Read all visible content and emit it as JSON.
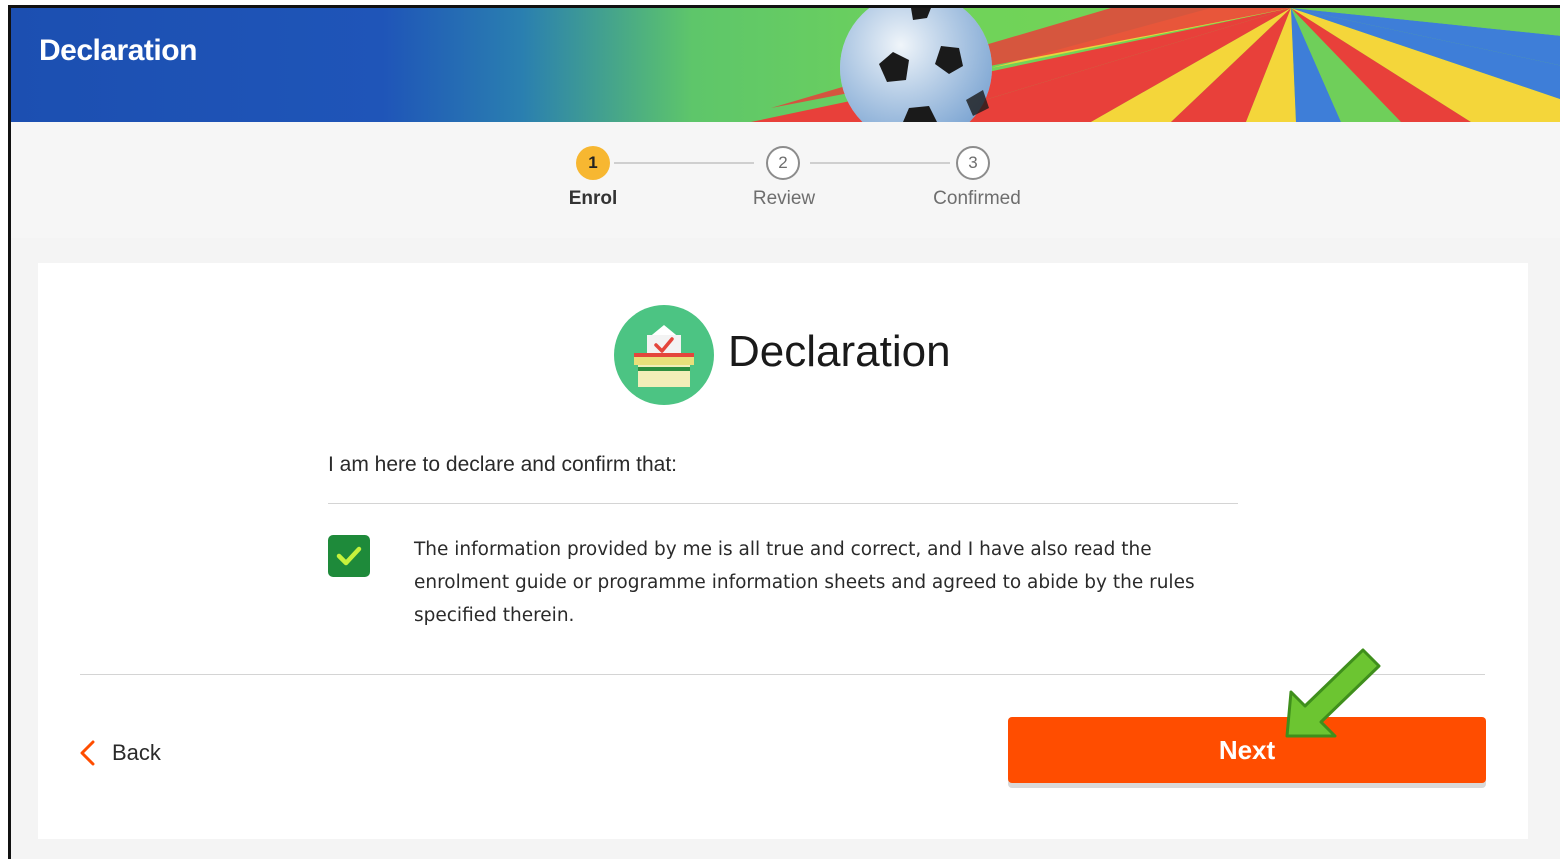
{
  "header": {
    "title": "Declaration"
  },
  "stepper": {
    "steps": [
      {
        "number": "1",
        "label": "Enrol",
        "state": "active"
      },
      {
        "number": "2",
        "label": "Review",
        "state": "inactive"
      },
      {
        "number": "3",
        "label": "Confirmed",
        "state": "inactive"
      }
    ]
  },
  "card": {
    "title": "Declaration",
    "icon": "ballot-box-icon",
    "intro": "I am here to declare and confirm that:",
    "declaration": {
      "checked": true,
      "text": "The information provided by me is all true and correct, and I have also read the enrolment guide or programme information sheets and agreed to abide by the rules specified therein."
    }
  },
  "actions": {
    "back_label": "Back",
    "next_label": "Next"
  },
  "colors": {
    "header_blue": "#1c4fb1",
    "step_active": "#f7b731",
    "checkbox_green": "#1e8a3a",
    "next_orange": "#ff4d00",
    "back_chevron": "#ff4d00",
    "pointer_arrow": "#6cc531"
  }
}
